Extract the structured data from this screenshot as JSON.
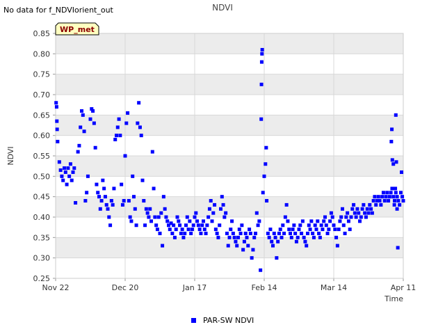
{
  "no_data_note": "No data for f_NDVIorient_out",
  "chart_data": {
    "type": "scatter",
    "title": "NDVI",
    "xlabel": "Time",
    "ylabel": "NDVI",
    "ylim": [
      0.25,
      0.85
    ],
    "xlim": [
      "Nov 22",
      "Apr 11"
    ],
    "x_ticks": [
      "Nov 22",
      "Dec 20",
      "Jan 17",
      "Feb 14",
      "Mar 14",
      "Apr 11"
    ],
    "y_ticks": [
      "0.25",
      "0.30",
      "0.35",
      "0.40",
      "0.45",
      "0.50",
      "0.55",
      "0.60",
      "0.65",
      "0.70",
      "0.75",
      "0.80",
      "0.85"
    ],
    "grid": true,
    "legend_position": "bottom-center",
    "badge": "WP_met",
    "colors": {
      "series": "#0000ff",
      "band": "#ececec",
      "badge_bg": "#ffffc0",
      "badge_text": "#8b0000"
    },
    "series": [
      {
        "name": "PAR-SW NDVI",
        "x_unit": "days since Nov 22",
        "points": [
          [
            0.2,
            0.68
          ],
          [
            0.4,
            0.67
          ],
          [
            0.5,
            0.635
          ],
          [
            0.6,
            0.615
          ],
          [
            0.8,
            0.585
          ],
          [
            1.5,
            0.535
          ],
          [
            2,
            0.515
          ],
          [
            2.5,
            0.5
          ],
          [
            3,
            0.49
          ],
          [
            3.5,
            0.52
          ],
          [
            4,
            0.51
          ],
          [
            4.5,
            0.48
          ],
          [
            5,
            0.52
          ],
          [
            5.5,
            0.5
          ],
          [
            6,
            0.53
          ],
          [
            6.5,
            0.49
          ],
          [
            7,
            0.51
          ],
          [
            7.5,
            0.52
          ],
          [
            8,
            0.435
          ],
          [
            9,
            0.56
          ],
          [
            9.5,
            0.575
          ],
          [
            10,
            0.62
          ],
          [
            10.5,
            0.66
          ],
          [
            11,
            0.65
          ],
          [
            11.5,
            0.61
          ],
          [
            12,
            0.44
          ],
          [
            12.5,
            0.46
          ],
          [
            13,
            0.5
          ],
          [
            14,
            0.64
          ],
          [
            14.5,
            0.665
          ],
          [
            15,
            0.66
          ],
          [
            15.5,
            0.63
          ],
          [
            16,
            0.57
          ],
          [
            16.5,
            0.48
          ],
          [
            17,
            0.46
          ],
          [
            17.5,
            0.45
          ],
          [
            18,
            0.42
          ],
          [
            18.5,
            0.44
          ],
          [
            19,
            0.49
          ],
          [
            19.5,
            0.47
          ],
          [
            20,
            0.45
          ],
          [
            20.5,
            0.43
          ],
          [
            21,
            0.42
          ],
          [
            21.5,
            0.4
          ],
          [
            22,
            0.38
          ],
          [
            22.5,
            0.44
          ],
          [
            23,
            0.43
          ],
          [
            23.5,
            0.47
          ],
          [
            24,
            0.59
          ],
          [
            24.5,
            0.6
          ],
          [
            25,
            0.62
          ],
          [
            25.5,
            0.64
          ],
          [
            26,
            0.6
          ],
          [
            26.5,
            0.48
          ],
          [
            27,
            0.43
          ],
          [
            27.5,
            0.44
          ],
          [
            28,
            0.55
          ],
          [
            28.5,
            0.63
          ],
          [
            29,
            0.655
          ],
          [
            29.5,
            0.44
          ],
          [
            30,
            0.4
          ],
          [
            30.5,
            0.39
          ],
          [
            31,
            0.5
          ],
          [
            31.5,
            0.45
          ],
          [
            32,
            0.42
          ],
          [
            32.5,
            0.38
          ],
          [
            33,
            0.63
          ],
          [
            33.5,
            0.68
          ],
          [
            34,
            0.62
          ],
          [
            34.5,
            0.6
          ],
          [
            35,
            0.49
          ],
          [
            35.5,
            0.44
          ],
          [
            36,
            0.38
          ],
          [
            36.5,
            0.42
          ],
          [
            37,
            0.41
          ],
          [
            37.5,
            0.4
          ],
          [
            38,
            0.42
          ],
          [
            38.5,
            0.39
          ],
          [
            39,
            0.56
          ],
          [
            39.5,
            0.47
          ],
          [
            40,
            0.4
          ],
          [
            40.5,
            0.38
          ],
          [
            41,
            0.37
          ],
          [
            41.5,
            0.4
          ],
          [
            42,
            0.36
          ],
          [
            42.5,
            0.41
          ],
          [
            43,
            0.33
          ],
          [
            43.5,
            0.45
          ],
          [
            44,
            0.42
          ],
          [
            44.5,
            0.4
          ],
          [
            45,
            0.39
          ],
          [
            45.5,
            0.38
          ],
          [
            46,
            0.37
          ],
          [
            46.5,
            0.385
          ],
          [
            47,
            0.36
          ],
          [
            47.5,
            0.38
          ],
          [
            48,
            0.35
          ],
          [
            48.5,
            0.37
          ],
          [
            49,
            0.4
          ],
          [
            49.5,
            0.39
          ],
          [
            50,
            0.38
          ],
          [
            50.5,
            0.36
          ],
          [
            51,
            0.37
          ],
          [
            51.5,
            0.35
          ],
          [
            52,
            0.36
          ],
          [
            52.5,
            0.38
          ],
          [
            53,
            0.4
          ],
          [
            53.5,
            0.37
          ],
          [
            54,
            0.39
          ],
          [
            54.5,
            0.36
          ],
          [
            55,
            0.37
          ],
          [
            55.5,
            0.38
          ],
          [
            56,
            0.4
          ],
          [
            56.5,
            0.41
          ],
          [
            57,
            0.39
          ],
          [
            57.5,
            0.38
          ],
          [
            58,
            0.37
          ],
          [
            58.5,
            0.36
          ],
          [
            59,
            0.38
          ],
          [
            59.5,
            0.39
          ],
          [
            60,
            0.37
          ],
          [
            60.5,
            0.36
          ],
          [
            61,
            0.38
          ],
          [
            61.5,
            0.4
          ],
          [
            62,
            0.42
          ],
          [
            62.5,
            0.44
          ],
          [
            63,
            0.39
          ],
          [
            63.5,
            0.41
          ],
          [
            64,
            0.43
          ],
          [
            64.5,
            0.37
          ],
          [
            65,
            0.36
          ],
          [
            65.5,
            0.35
          ],
          [
            66,
            0.38
          ],
          [
            66.5,
            0.42
          ],
          [
            67,
            0.45
          ],
          [
            67.5,
            0.43
          ],
          [
            68,
            0.4
          ],
          [
            68.5,
            0.41
          ],
          [
            69,
            0.36
          ],
          [
            69.5,
            0.33
          ],
          [
            70,
            0.35
          ],
          [
            70.5,
            0.37
          ],
          [
            71,
            0.39
          ],
          [
            71.5,
            0.36
          ],
          [
            72,
            0.35
          ],
          [
            72.5,
            0.34
          ],
          [
            73,
            0.33
          ],
          [
            73.5,
            0.35
          ],
          [
            74,
            0.37
          ],
          [
            74.5,
            0.36
          ],
          [
            75,
            0.38
          ],
          [
            75.5,
            0.32
          ],
          [
            76,
            0.34
          ],
          [
            76.5,
            0.36
          ],
          [
            77,
            0.35
          ],
          [
            77.5,
            0.33
          ],
          [
            78,
            0.37
          ],
          [
            78.5,
            0.36
          ],
          [
            79,
            0.3
          ],
          [
            79.5,
            0.32
          ],
          [
            80,
            0.35
          ],
          [
            80.5,
            0.36
          ],
          [
            81,
            0.41
          ],
          [
            81.5,
            0.38
          ],
          [
            82,
            0.39
          ],
          [
            82.5,
            0.27
          ],
          [
            82.8,
            0.64
          ],
          [
            82.9,
            0.725
          ],
          [
            83,
            0.78
          ],
          [
            83.1,
            0.8
          ],
          [
            83.2,
            0.81
          ],
          [
            83.5,
            0.46
          ],
          [
            84,
            0.5
          ],
          [
            84.5,
            0.53
          ],
          [
            84.8,
            0.57
          ],
          [
            85,
            0.44
          ],
          [
            85.5,
            0.36
          ],
          [
            86,
            0.35
          ],
          [
            86.5,
            0.37
          ],
          [
            87,
            0.34
          ],
          [
            87.5,
            0.33
          ],
          [
            88,
            0.36
          ],
          [
            88.5,
            0.35
          ],
          [
            89,
            0.3
          ],
          [
            89.5,
            0.34
          ],
          [
            90,
            0.36
          ],
          [
            90.5,
            0.37
          ],
          [
            91,
            0.35
          ],
          [
            91.5,
            0.38
          ],
          [
            92,
            0.36
          ],
          [
            92.5,
            0.4
          ],
          [
            93,
            0.43
          ],
          [
            93.5,
            0.39
          ],
          [
            94,
            0.37
          ],
          [
            94.5,
            0.36
          ],
          [
            95,
            0.35
          ],
          [
            95.5,
            0.37
          ],
          [
            96,
            0.38
          ],
          [
            96.5,
            0.36
          ],
          [
            97,
            0.34
          ],
          [
            97.5,
            0.35
          ],
          [
            98,
            0.37
          ],
          [
            98.5,
            0.38
          ],
          [
            99,
            0.36
          ],
          [
            99.5,
            0.39
          ],
          [
            100,
            0.35
          ],
          [
            100.5,
            0.34
          ],
          [
            101,
            0.33
          ],
          [
            101.5,
            0.36
          ],
          [
            102,
            0.38
          ],
          [
            102.5,
            0.37
          ],
          [
            103,
            0.39
          ],
          [
            103.5,
            0.36
          ],
          [
            104,
            0.35
          ],
          [
            104.5,
            0.38
          ],
          [
            105,
            0.37
          ],
          [
            105.5,
            0.39
          ],
          [
            106,
            0.36
          ],
          [
            106.5,
            0.35
          ],
          [
            107,
            0.38
          ],
          [
            107.5,
            0.37
          ],
          [
            108,
            0.39
          ],
          [
            108.5,
            0.4
          ],
          [
            109,
            0.38
          ],
          [
            109.5,
            0.36
          ],
          [
            110,
            0.37
          ],
          [
            110.5,
            0.39
          ],
          [
            111,
            0.41
          ],
          [
            111.5,
            0.4
          ],
          [
            112,
            0.38
          ],
          [
            112.5,
            0.37
          ],
          [
            113,
            0.35
          ],
          [
            113.5,
            0.33
          ],
          [
            114,
            0.37
          ],
          [
            114.5,
            0.39
          ],
          [
            115,
            0.4
          ],
          [
            115.5,
            0.42
          ],
          [
            116,
            0.38
          ],
          [
            116.5,
            0.36
          ],
          [
            117,
            0.4
          ],
          [
            117.5,
            0.41
          ],
          [
            118,
            0.39
          ],
          [
            118.5,
            0.37
          ],
          [
            119,
            0.4
          ],
          [
            119.5,
            0.42
          ],
          [
            120,
            0.43
          ],
          [
            120.5,
            0.41
          ],
          [
            121,
            0.4
          ],
          [
            121.5,
            0.42
          ],
          [
            122,
            0.41
          ],
          [
            122.5,
            0.39
          ],
          [
            123,
            0.4
          ],
          [
            123.5,
            0.42
          ],
          [
            124,
            0.43
          ],
          [
            124.5,
            0.41
          ],
          [
            125,
            0.4
          ],
          [
            125.5,
            0.42
          ],
          [
            126,
            0.41
          ],
          [
            126.5,
            0.43
          ],
          [
            127,
            0.42
          ],
          [
            127.5,
            0.41
          ],
          [
            128,
            0.44
          ],
          [
            128.5,
            0.45
          ],
          [
            129,
            0.43
          ],
          [
            129.5,
            0.44
          ],
          [
            130,
            0.45
          ],
          [
            130.5,
            0.44
          ],
          [
            131,
            0.43
          ],
          [
            131.5,
            0.45
          ],
          [
            132,
            0.46
          ],
          [
            132.5,
            0.44
          ],
          [
            133,
            0.45
          ],
          [
            133.5,
            0.46
          ],
          [
            134,
            0.44
          ],
          [
            134.5,
            0.45
          ],
          [
            135,
            0.46
          ],
          [
            135.5,
            0.47
          ],
          [
            136,
            0.45
          ],
          [
            136.5,
            0.44
          ],
          [
            137,
            0.46
          ],
          [
            137.5,
            0.45
          ],
          [
            135.2,
            0.585
          ],
          [
            135.4,
            0.615
          ],
          [
            135.6,
            0.54
          ],
          [
            136,
            0.53
          ],
          [
            136.4,
            0.43
          ],
          [
            136.8,
            0.47
          ],
          [
            137,
            0.65
          ],
          [
            137.2,
            0.535
          ],
          [
            137.5,
            0.42
          ],
          [
            137.8,
            0.325
          ],
          [
            138,
            0.44
          ],
          [
            138.5,
            0.43
          ],
          [
            139,
            0.46
          ],
          [
            139.3,
            0.51
          ],
          [
            139.6,
            0.45
          ],
          [
            140,
            0.44
          ]
        ]
      }
    ]
  }
}
